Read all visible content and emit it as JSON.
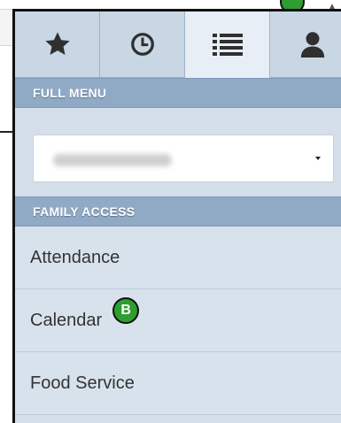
{
  "tabs": [
    {
      "icon": "star-icon"
    },
    {
      "icon": "clock-icon"
    },
    {
      "icon": "list-icon",
      "active": true
    },
    {
      "icon": "user-icon"
    }
  ],
  "full_menu": {
    "header": "FULL MENU"
  },
  "family_access": {
    "header": "FAMILY ACCESS",
    "items": [
      "Attendance",
      "Calendar",
      "Food Service"
    ]
  },
  "annotation": {
    "badge": "B"
  },
  "colors": {
    "header": "#90aac6",
    "panel": "#d5dfea",
    "badge": "#2e9e2e"
  }
}
